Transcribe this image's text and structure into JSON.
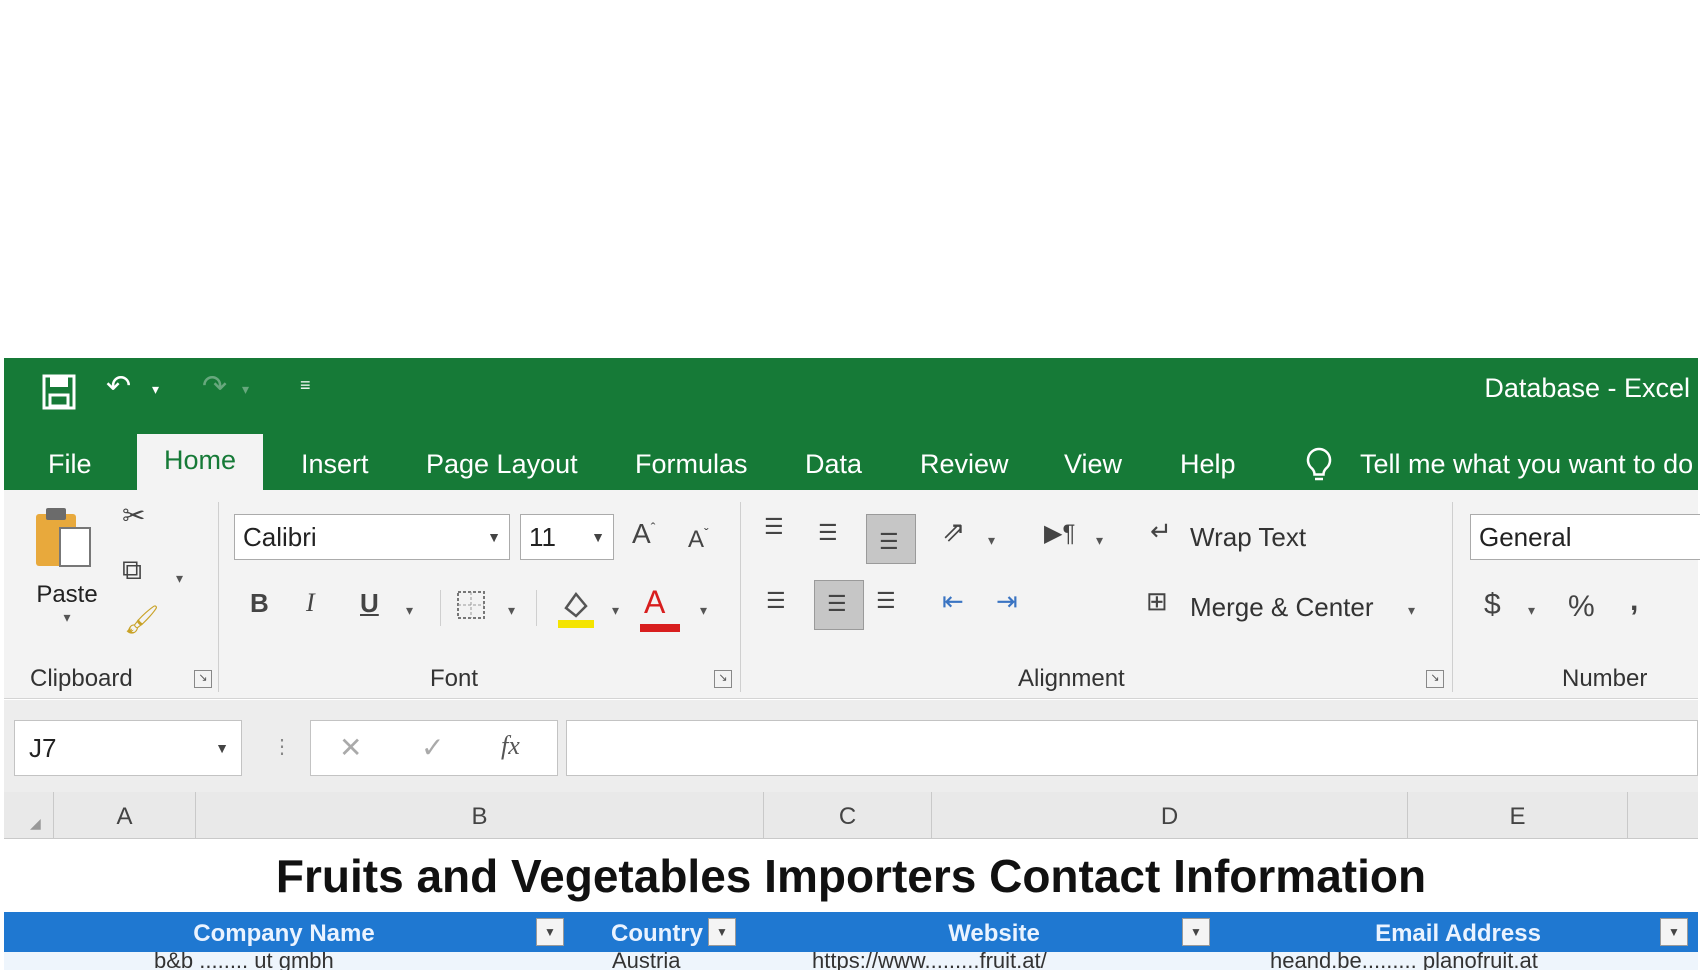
{
  "window": {
    "title": "Database  -  Excel"
  },
  "tabs": [
    "File",
    "Home",
    "Insert",
    "Page Layout",
    "Formulas",
    "Data",
    "Review",
    "View",
    "Help"
  ],
  "active_tab": "Home",
  "tell_me": "Tell me what you want to do",
  "ribbon": {
    "clipboard": {
      "label": "Clipboard",
      "paste": "Paste"
    },
    "font": {
      "label": "Font",
      "name": "Calibri",
      "size": "11",
      "bold": "B",
      "italic": "I",
      "underline": "U",
      "font_color_glyph": "A",
      "grow": "A",
      "shrink": "A",
      "fill_color": "#f4e400",
      "font_color": "#d81e1e"
    },
    "alignment": {
      "label": "Alignment",
      "wrap_text": "Wrap Text",
      "merge_center": "Merge & Center"
    },
    "number": {
      "label": "Number",
      "format": "General",
      "currency": "$",
      "percent": "%",
      "comma": ","
    }
  },
  "formula_bar": {
    "name_box": "J7",
    "fx": "fx",
    "content": ""
  },
  "columns": [
    "A",
    "B",
    "C",
    "D",
    "E"
  ],
  "sheet": {
    "title": "Fruits and Vegetables Importers Contact Information",
    "headers": [
      "Company Name",
      "Country",
      "Website",
      "Email Address"
    ],
    "row1": [
      "b&b ........ ut gmbh",
      "Austria",
      "https://www.........fruit.at/",
      "heand.be......... planofruit.at"
    ]
  },
  "colors": {
    "excel_green": "#167a37",
    "table_header_blue": "#1f78d1"
  }
}
